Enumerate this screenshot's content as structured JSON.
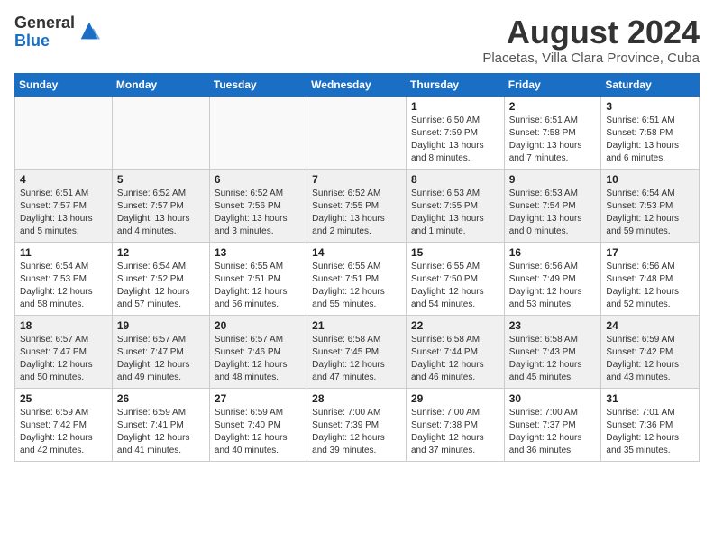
{
  "header": {
    "logo_general": "General",
    "logo_blue": "Blue",
    "month_title": "August 2024",
    "location": "Placetas, Villa Clara Province, Cuba"
  },
  "days_of_week": [
    "Sunday",
    "Monday",
    "Tuesday",
    "Wednesday",
    "Thursday",
    "Friday",
    "Saturday"
  ],
  "weeks": [
    [
      {
        "day": "",
        "info": ""
      },
      {
        "day": "",
        "info": ""
      },
      {
        "day": "",
        "info": ""
      },
      {
        "day": "",
        "info": ""
      },
      {
        "day": "1",
        "info": "Sunrise: 6:50 AM\nSunset: 7:59 PM\nDaylight: 13 hours\nand 8 minutes."
      },
      {
        "day": "2",
        "info": "Sunrise: 6:51 AM\nSunset: 7:58 PM\nDaylight: 13 hours\nand 7 minutes."
      },
      {
        "day": "3",
        "info": "Sunrise: 6:51 AM\nSunset: 7:58 PM\nDaylight: 13 hours\nand 6 minutes."
      }
    ],
    [
      {
        "day": "4",
        "info": "Sunrise: 6:51 AM\nSunset: 7:57 PM\nDaylight: 13 hours\nand 5 minutes."
      },
      {
        "day": "5",
        "info": "Sunrise: 6:52 AM\nSunset: 7:57 PM\nDaylight: 13 hours\nand 4 minutes."
      },
      {
        "day": "6",
        "info": "Sunrise: 6:52 AM\nSunset: 7:56 PM\nDaylight: 13 hours\nand 3 minutes."
      },
      {
        "day": "7",
        "info": "Sunrise: 6:52 AM\nSunset: 7:55 PM\nDaylight: 13 hours\nand 2 minutes."
      },
      {
        "day": "8",
        "info": "Sunrise: 6:53 AM\nSunset: 7:55 PM\nDaylight: 13 hours\nand 1 minute."
      },
      {
        "day": "9",
        "info": "Sunrise: 6:53 AM\nSunset: 7:54 PM\nDaylight: 13 hours\nand 0 minutes."
      },
      {
        "day": "10",
        "info": "Sunrise: 6:54 AM\nSunset: 7:53 PM\nDaylight: 12 hours\nand 59 minutes."
      }
    ],
    [
      {
        "day": "11",
        "info": "Sunrise: 6:54 AM\nSunset: 7:53 PM\nDaylight: 12 hours\nand 58 minutes."
      },
      {
        "day": "12",
        "info": "Sunrise: 6:54 AM\nSunset: 7:52 PM\nDaylight: 12 hours\nand 57 minutes."
      },
      {
        "day": "13",
        "info": "Sunrise: 6:55 AM\nSunset: 7:51 PM\nDaylight: 12 hours\nand 56 minutes."
      },
      {
        "day": "14",
        "info": "Sunrise: 6:55 AM\nSunset: 7:51 PM\nDaylight: 12 hours\nand 55 minutes."
      },
      {
        "day": "15",
        "info": "Sunrise: 6:55 AM\nSunset: 7:50 PM\nDaylight: 12 hours\nand 54 minutes."
      },
      {
        "day": "16",
        "info": "Sunrise: 6:56 AM\nSunset: 7:49 PM\nDaylight: 12 hours\nand 53 minutes."
      },
      {
        "day": "17",
        "info": "Sunrise: 6:56 AM\nSunset: 7:48 PM\nDaylight: 12 hours\nand 52 minutes."
      }
    ],
    [
      {
        "day": "18",
        "info": "Sunrise: 6:57 AM\nSunset: 7:47 PM\nDaylight: 12 hours\nand 50 minutes."
      },
      {
        "day": "19",
        "info": "Sunrise: 6:57 AM\nSunset: 7:47 PM\nDaylight: 12 hours\nand 49 minutes."
      },
      {
        "day": "20",
        "info": "Sunrise: 6:57 AM\nSunset: 7:46 PM\nDaylight: 12 hours\nand 48 minutes."
      },
      {
        "day": "21",
        "info": "Sunrise: 6:58 AM\nSunset: 7:45 PM\nDaylight: 12 hours\nand 47 minutes."
      },
      {
        "day": "22",
        "info": "Sunrise: 6:58 AM\nSunset: 7:44 PM\nDaylight: 12 hours\nand 46 minutes."
      },
      {
        "day": "23",
        "info": "Sunrise: 6:58 AM\nSunset: 7:43 PM\nDaylight: 12 hours\nand 45 minutes."
      },
      {
        "day": "24",
        "info": "Sunrise: 6:59 AM\nSunset: 7:42 PM\nDaylight: 12 hours\nand 43 minutes."
      }
    ],
    [
      {
        "day": "25",
        "info": "Sunrise: 6:59 AM\nSunset: 7:42 PM\nDaylight: 12 hours\nand 42 minutes."
      },
      {
        "day": "26",
        "info": "Sunrise: 6:59 AM\nSunset: 7:41 PM\nDaylight: 12 hours\nand 41 minutes."
      },
      {
        "day": "27",
        "info": "Sunrise: 6:59 AM\nSunset: 7:40 PM\nDaylight: 12 hours\nand 40 minutes."
      },
      {
        "day": "28",
        "info": "Sunrise: 7:00 AM\nSunset: 7:39 PM\nDaylight: 12 hours\nand 39 minutes."
      },
      {
        "day": "29",
        "info": "Sunrise: 7:00 AM\nSunset: 7:38 PM\nDaylight: 12 hours\nand 37 minutes."
      },
      {
        "day": "30",
        "info": "Sunrise: 7:00 AM\nSunset: 7:37 PM\nDaylight: 12 hours\nand 36 minutes."
      },
      {
        "day": "31",
        "info": "Sunrise: 7:01 AM\nSunset: 7:36 PM\nDaylight: 12 hours\nand 35 minutes."
      }
    ]
  ]
}
